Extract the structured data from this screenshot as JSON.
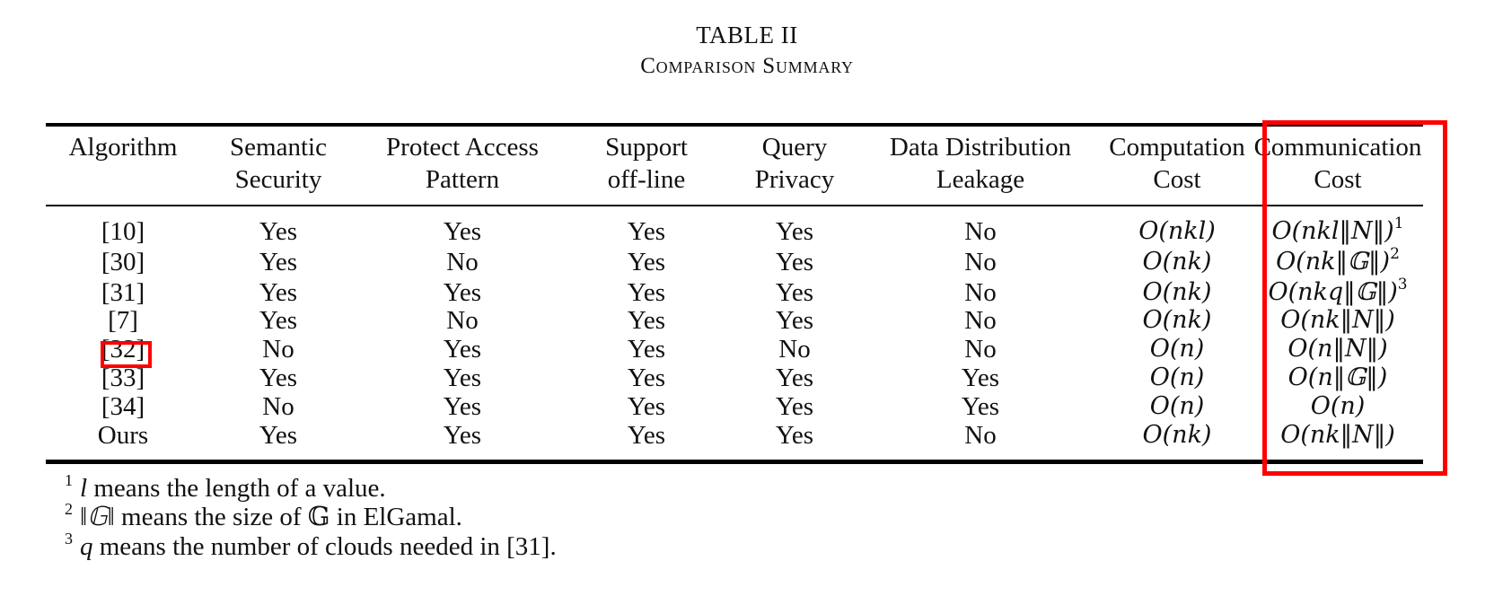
{
  "caption": {
    "label": "TABLE II",
    "title": "Comparison Summary"
  },
  "table": {
    "columns": [
      [
        "Algorithm"
      ],
      [
        "Semantic",
        "Security"
      ],
      [
        "Protect Access",
        "Pattern"
      ],
      [
        "Support",
        "off-line"
      ],
      [
        "Query",
        "Privacy"
      ],
      [
        "Data Distribution",
        "Leakage"
      ],
      [
        "Computation",
        "Cost"
      ],
      [
        "Communication",
        "Cost"
      ]
    ],
    "rows": [
      {
        "algorithm": "[10]",
        "semantic_security": "Yes",
        "protect_access_pattern": "Yes",
        "support_offline": "Yes",
        "query_privacy": "Yes",
        "data_distribution_leakage": "No",
        "computation_cost": "O(nkl)",
        "communication_cost": "O(nkl‖N‖)",
        "communication_note": "1"
      },
      {
        "algorithm": "[30]",
        "semantic_security": "Yes",
        "protect_access_pattern": "No",
        "support_offline": "Yes",
        "query_privacy": "Yes",
        "data_distribution_leakage": "No",
        "computation_cost": "O(nk)",
        "communication_cost": "O(nk‖𝔾‖)",
        "communication_note": "2"
      },
      {
        "algorithm": "[31]",
        "semantic_security": "Yes",
        "protect_access_pattern": "Yes",
        "support_offline": "Yes",
        "query_privacy": "Yes",
        "data_distribution_leakage": "No",
        "computation_cost": "O(nk)",
        "communication_cost": "O(nkq‖𝔾‖)",
        "communication_note": "3"
      },
      {
        "algorithm": "[7]",
        "semantic_security": "Yes",
        "protect_access_pattern": "No",
        "support_offline": "Yes",
        "query_privacy": "Yes",
        "data_distribution_leakage": "No",
        "computation_cost": "O(nk)",
        "communication_cost": "O(nk‖N‖)",
        "communication_note": ""
      },
      {
        "algorithm": "[32]",
        "semantic_security": "No",
        "protect_access_pattern": "Yes",
        "support_offline": "Yes",
        "query_privacy": "No",
        "data_distribution_leakage": "No",
        "computation_cost": "O(n)",
        "communication_cost": "O(n‖N‖)",
        "communication_note": ""
      },
      {
        "algorithm": "[33]",
        "semantic_security": "Yes",
        "protect_access_pattern": "Yes",
        "support_offline": "Yes",
        "query_privacy": "Yes",
        "data_distribution_leakage": "Yes",
        "computation_cost": "O(n)",
        "communication_cost": "O(n‖𝔾‖)",
        "communication_note": ""
      },
      {
        "algorithm": "[34]",
        "semantic_security": "No",
        "protect_access_pattern": "Yes",
        "support_offline": "Yes",
        "query_privacy": "Yes",
        "data_distribution_leakage": "Yes",
        "computation_cost": "O(n)",
        "communication_cost": "O(n)",
        "communication_note": ""
      },
      {
        "algorithm": "Ours",
        "semantic_security": "Yes",
        "protect_access_pattern": "Yes",
        "support_offline": "Yes",
        "query_privacy": "Yes",
        "data_distribution_leakage": "No",
        "computation_cost": "O(nk)",
        "communication_cost": "O(nk‖N‖)",
        "communication_note": ""
      }
    ]
  },
  "footnotes": [
    {
      "mark": "1",
      "symbol": "l",
      "text": " means the length of a value."
    },
    {
      "mark": "2",
      "symbol": "‖𝔾‖",
      "text": " means the size of 𝔾 in ElGamal."
    },
    {
      "mark": "3",
      "symbol": "q",
      "text": " means the number of clouds needed in [31]."
    }
  ],
  "annotations": {
    "highlight_color": "#ff0000",
    "highlighted_column": "Communication Cost",
    "highlighted_cell": "[32]"
  }
}
